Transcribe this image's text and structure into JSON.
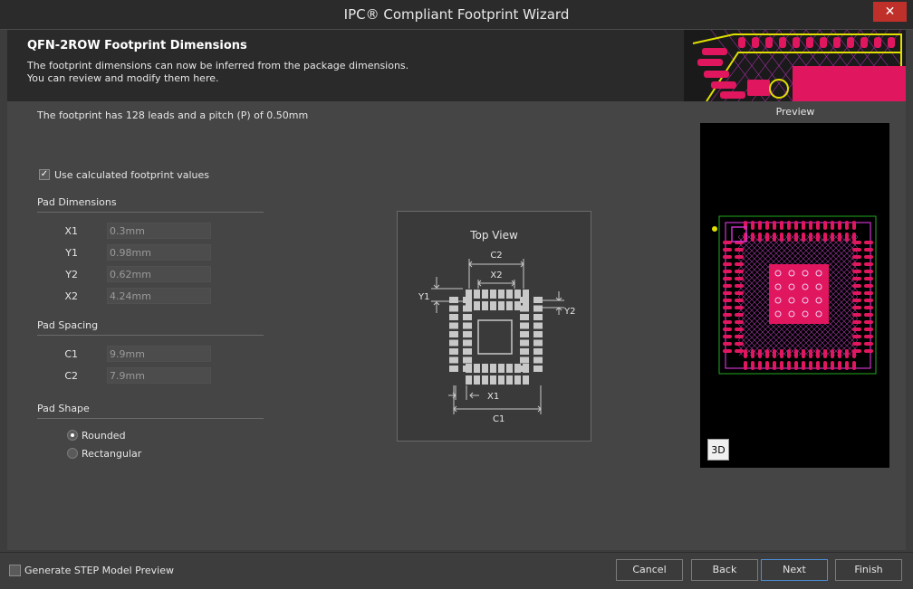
{
  "window": {
    "title": "IPC® Compliant Footprint Wizard",
    "close_glyph": "✕"
  },
  "header": {
    "title": "QFN-2ROW Footprint Dimensions",
    "subtitle": "The footprint dimensions can now be inferred from the package dimensions.\nYou can review and modify them here."
  },
  "info_text": "The footprint has 128 leads and a pitch (P) of 0.50mm",
  "use_calculated": {
    "label": "Use calculated footprint values",
    "checked": true
  },
  "pad_dimensions": {
    "heading": "Pad Dimensions",
    "fields": [
      {
        "label": "X1",
        "value": "0.3mm"
      },
      {
        "label": "Y1",
        "value": "0.98mm"
      },
      {
        "label": "Y2",
        "value": "0.62mm"
      },
      {
        "label": "X2",
        "value": "4.24mm"
      }
    ]
  },
  "pad_spacing": {
    "heading": "Pad Spacing",
    "fields": [
      {
        "label": "C1",
        "value": "9.9mm"
      },
      {
        "label": "C2",
        "value": "7.9mm"
      }
    ]
  },
  "pad_shape": {
    "heading": "Pad Shape",
    "options": [
      {
        "label": "Rounded",
        "selected": true
      },
      {
        "label": "Rectangular",
        "selected": false
      }
    ]
  },
  "top_view": {
    "title": "Top View",
    "labels": {
      "c2": "C2",
      "x2": "X2",
      "y1": "Y1",
      "y2": "Y2",
      "x1": "X1",
      "c1": "C1"
    }
  },
  "preview": {
    "label": "Preview",
    "btn_3d": "3D"
  },
  "footer": {
    "step_preview": {
      "label": "Generate STEP Model Preview",
      "checked": false
    },
    "cancel": "Cancel",
    "back": "Back",
    "next": "Next",
    "finish": "Finish"
  },
  "colors": {
    "pad": "#e0165e",
    "outline": "#cc33cc",
    "silk": "#e0e000",
    "courtyard": "#22aa22"
  }
}
